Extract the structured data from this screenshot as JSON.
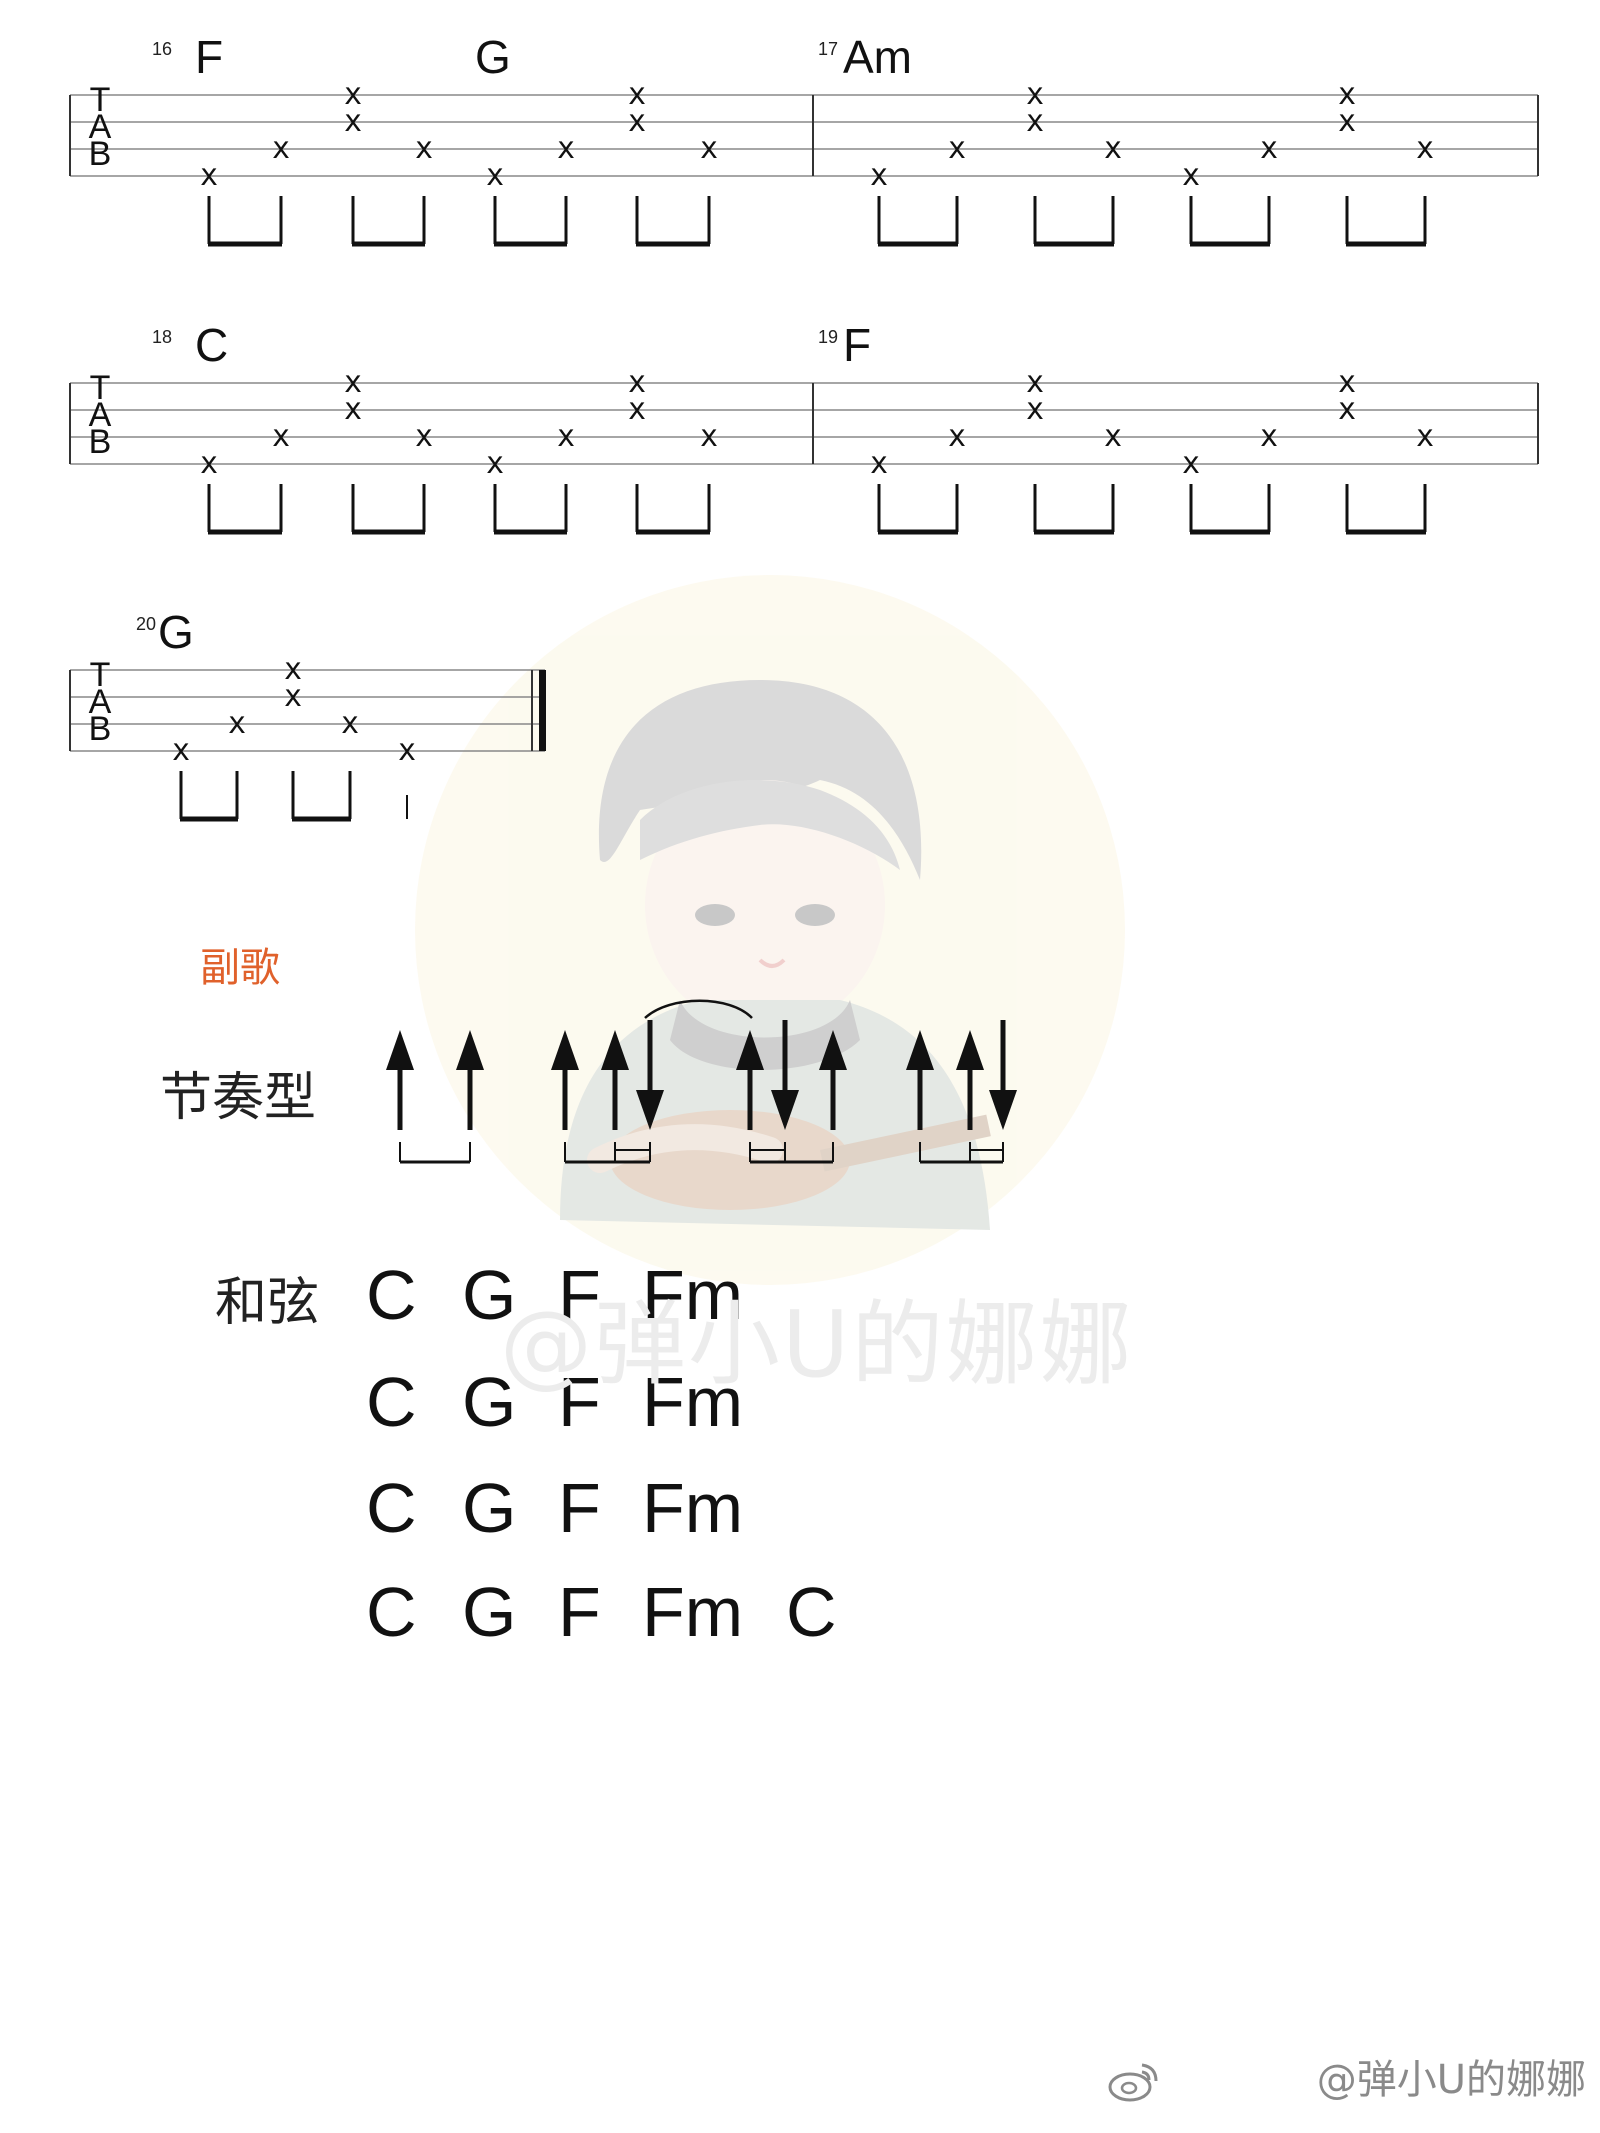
{
  "tab": {
    "clef_letters": [
      "T",
      "A",
      "B"
    ],
    "note_mark": "x",
    "systems": [
      {
        "measures": [
          {
            "number": "16",
            "chords": [
              "F",
              "G"
            ]
          },
          {
            "number": "17",
            "chords": [
              "Am"
            ]
          }
        ]
      },
      {
        "measures": [
          {
            "number": "18",
            "chords": [
              "C"
            ]
          },
          {
            "number": "19",
            "chords": [
              "F"
            ]
          }
        ]
      },
      {
        "measures": [
          {
            "number": "20",
            "chords": [
              "G"
            ]
          }
        ]
      }
    ]
  },
  "section": {
    "label": "副歌"
  },
  "rhythm": {
    "label": "节奏型",
    "groups": [
      [
        "up",
        "up"
      ],
      [
        "up",
        "up",
        "down"
      ],
      [
        "up",
        "down",
        "up"
      ],
      [
        "up",
        "up",
        "down"
      ]
    ],
    "tie": "between groups 2 and 3"
  },
  "chords": {
    "label": "和弦",
    "rows": [
      [
        "C",
        "G",
        "F",
        "Fm"
      ],
      [
        "C",
        "G",
        "F",
        "Fm"
      ],
      [
        "C",
        "G",
        "F",
        "Fm"
      ],
      [
        "C",
        "G",
        "F",
        "Fm",
        "C"
      ]
    ]
  },
  "watermark": {
    "text": "@弹小U的娜娜"
  },
  "credit": {
    "text": "@弹小U的娜娜",
    "logo_icon": "weibo-icon"
  }
}
